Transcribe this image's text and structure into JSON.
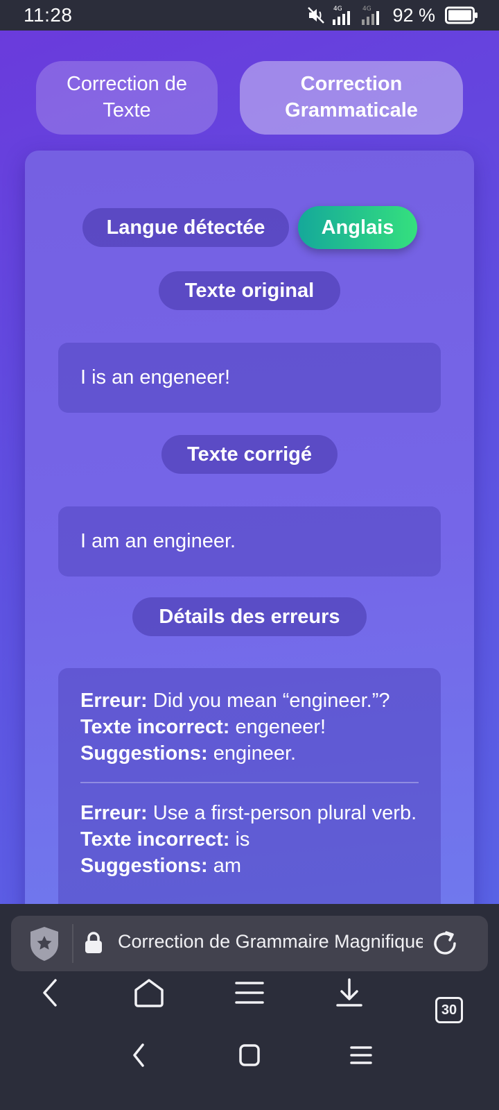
{
  "status_bar": {
    "time": "11:28",
    "battery_percent": "92 %",
    "network_1": "4G",
    "network_2": "4G",
    "icons": [
      "mute-icon",
      "signal-icon",
      "signal-icon",
      "battery-icon"
    ]
  },
  "tabs": [
    {
      "label": "Correction de\nTexte",
      "active": false
    },
    {
      "label": "Correction\nGrammaticale",
      "active": true
    }
  ],
  "language": {
    "label": "Langue détectée",
    "value": "Anglais"
  },
  "original": {
    "label": "Texte original",
    "text": "I is an engeneer!"
  },
  "corrected": {
    "label": "Texte corrigé",
    "text": "I am an engineer."
  },
  "details": {
    "label": "Détails des erreurs",
    "errors": [
      {
        "error_label": "Erreur:",
        "error": "Did you mean “engineer.”?",
        "incorrect_label": "Texte incorrect:",
        "incorrect": "engeneer!",
        "suggestions_label": "Suggestions:",
        "suggestions": "engineer."
      },
      {
        "error_label": "Erreur:",
        "error": "Use a first-person plural verb.",
        "incorrect_label": "Texte incorrect:",
        "incorrect": "is",
        "suggestions_label": "Suggestions:",
        "suggestions": "am"
      }
    ]
  },
  "browser": {
    "url_title": "Correction de Grammaire Magnifique",
    "tab_count": "30",
    "icons": [
      "shield-icon",
      "lock-icon",
      "reload-icon",
      "back-icon",
      "home-icon",
      "menu-icon",
      "download-icon",
      "tabs-icon"
    ]
  },
  "colors": {
    "accent_gradient_start": "#15a89a",
    "accent_gradient_end": "#35e07e",
    "background": "#6a3bdc",
    "chrome": "#2b2d3a"
  }
}
